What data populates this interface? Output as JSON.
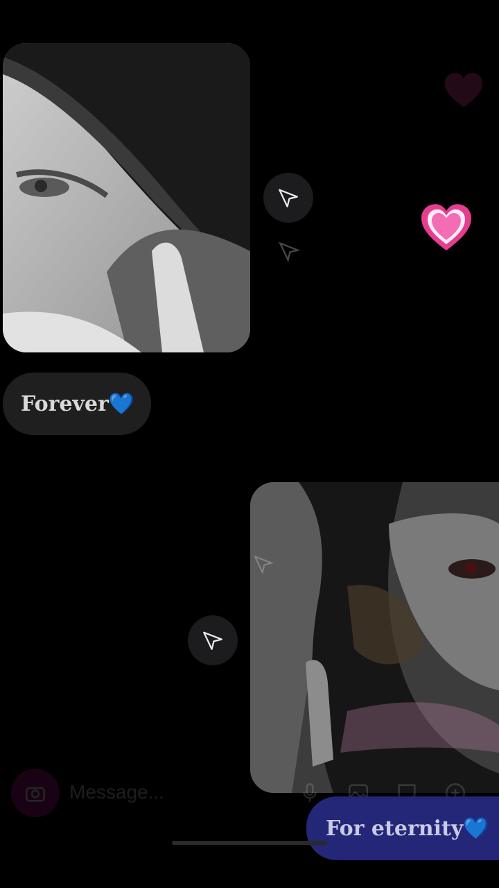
{
  "messages": {
    "received_caption": "Forever💙",
    "sent_caption": "For eternity💙"
  },
  "composer": {
    "placeholder": "Message..."
  },
  "reactions": {
    "emoji": "💗"
  },
  "colors": {
    "background": "#000000",
    "received_bubble": "#1f1f20",
    "sent_bubble": "#242778",
    "heart_pink": "#f25aa8"
  },
  "icons": {
    "share": "paper-plane-icon",
    "camera": "camera-icon",
    "mic": "mic-icon",
    "gallery": "image-icon",
    "sticker": "sticker-icon",
    "add": "plus-icon"
  }
}
